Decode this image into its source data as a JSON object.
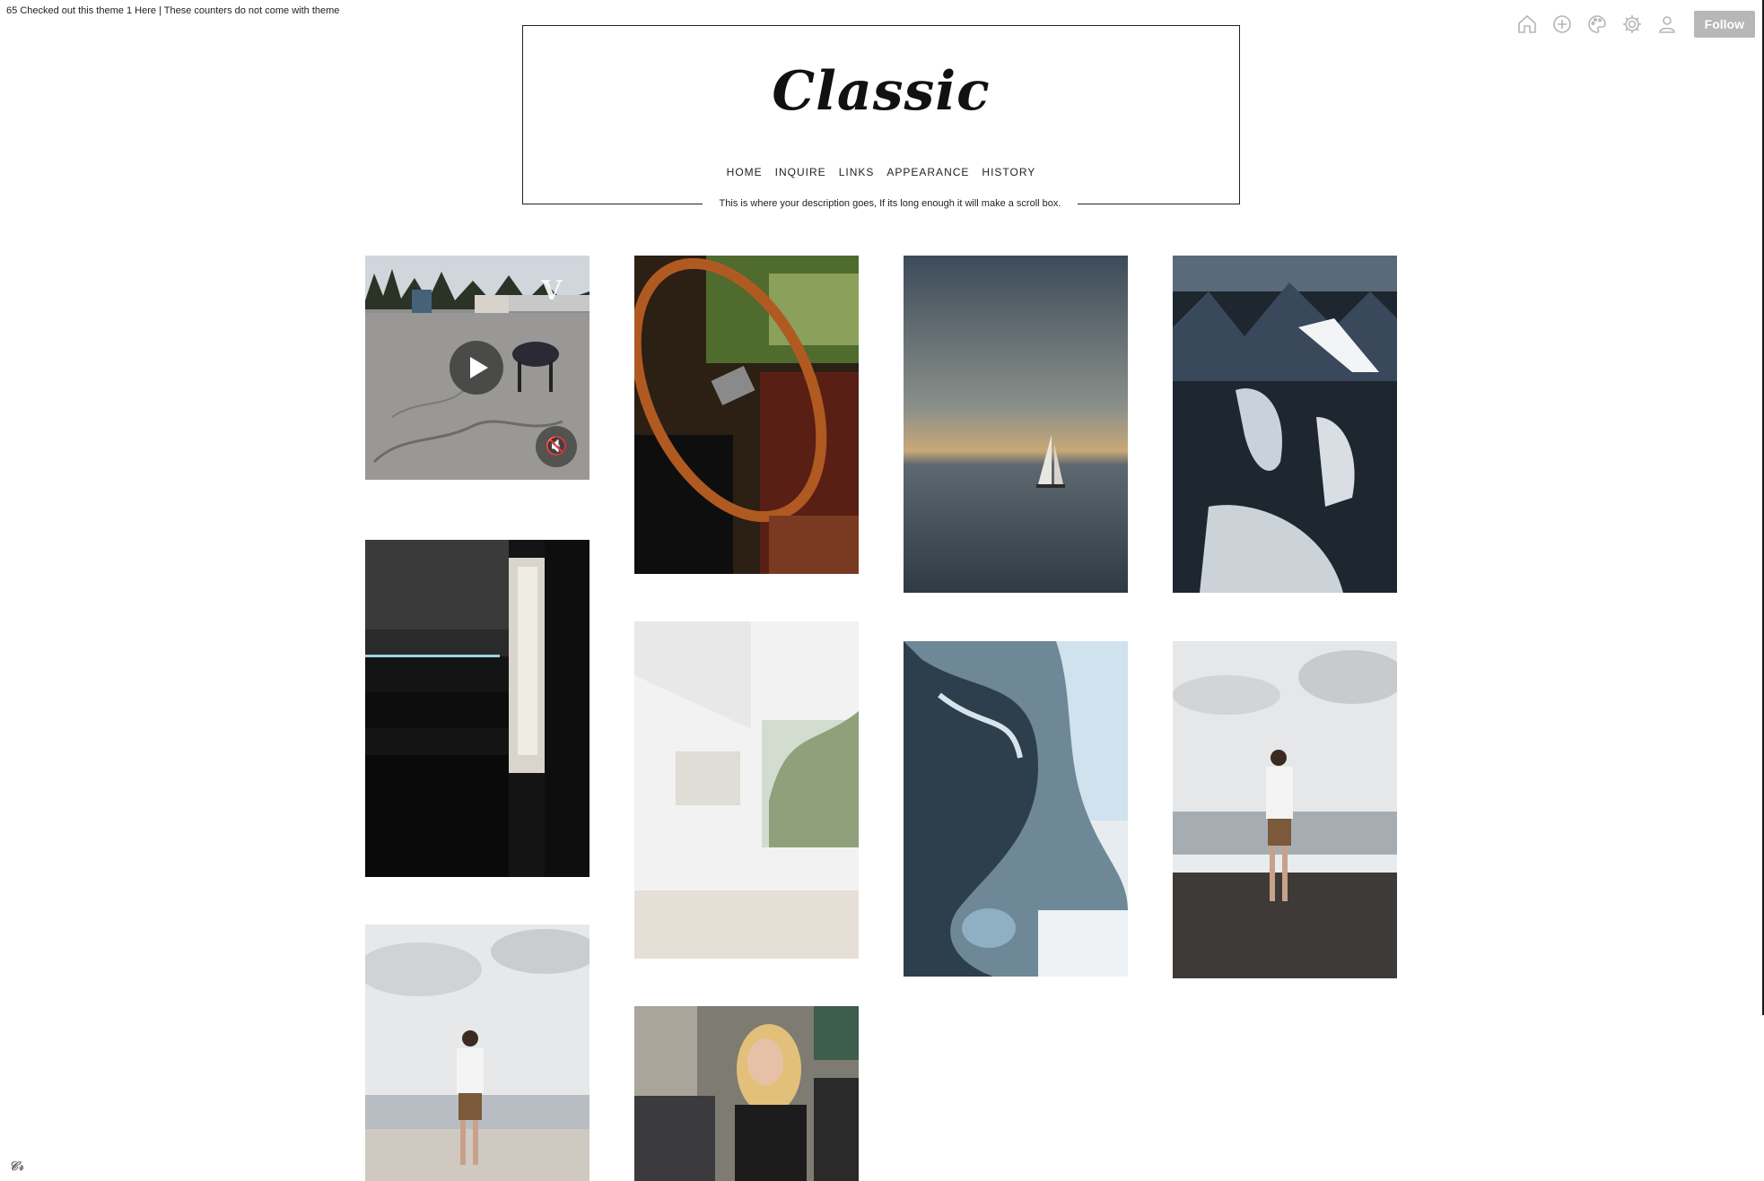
{
  "counter": {
    "count": "65",
    "prefix_text": "Checked out this theme",
    "count2": "1",
    "link_text": "Here",
    "separator": "|",
    "note": "These counters do not come with theme"
  },
  "topbar": {
    "icons": [
      "home-icon",
      "plus-icon",
      "palette-icon",
      "gear-icon",
      "user-icon"
    ],
    "follow_label": "Follow"
  },
  "header": {
    "title": "Classic",
    "nav": [
      "HOME",
      "INQUIRE",
      "LINKS",
      "APPEARANCE",
      "HISTORY"
    ],
    "description": "This is where your description goes, If its long enough it will make a scroll box."
  },
  "posts": [
    {
      "type": "video",
      "subject": "robot dog in parking lot"
    },
    {
      "type": "photo",
      "subject": "vintage car steering wheel"
    },
    {
      "type": "photo",
      "subject": "sailboat at sea"
    },
    {
      "type": "photo",
      "subject": "snowy mountains"
    },
    {
      "type": "photo",
      "subject": "dark kitchen interior"
    },
    {
      "type": "photo",
      "subject": "white room with window"
    },
    {
      "type": "photo",
      "subject": "ocean wave"
    },
    {
      "type": "photo",
      "subject": "man on beach"
    },
    {
      "type": "photo",
      "subject": "man on beach"
    },
    {
      "type": "photo",
      "subject": "woman in street crowd"
    }
  ],
  "colors": {
    "follow_bg": "#b7b7b7",
    "text": "#222222",
    "border": "#222222"
  }
}
